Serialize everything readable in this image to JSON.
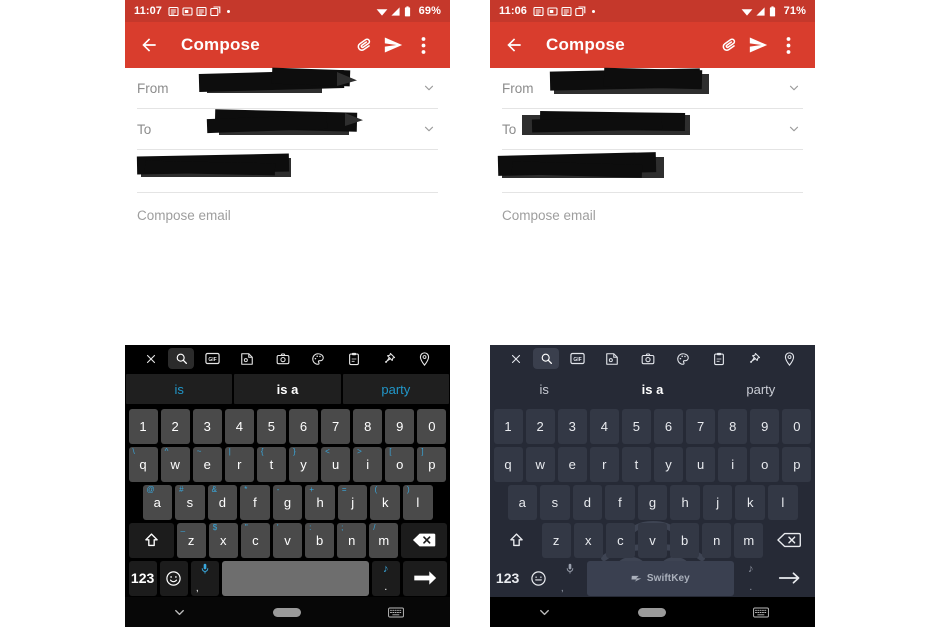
{
  "panels": [
    {
      "id": "left",
      "theme": "dark",
      "status": {
        "time": "11:07",
        "battery": "69%"
      },
      "appbar": {
        "title": "Compose",
        "back_icon": "arrow-back-icon",
        "attach_icon": "attachment-icon",
        "send_icon": "send-icon",
        "overflow_icon": "more-vert-icon"
      },
      "compose": {
        "from_label": "From",
        "to_label": "To",
        "subject_redacted": true,
        "body_placeholder": "Compose email"
      },
      "keyboard": {
        "toolbar": [
          "close-icon",
          "search-icon",
          "gif-icon",
          "sticker-icon",
          "camera-icon",
          "theme-palette-icon",
          "clipboard-icon",
          "pin-icon",
          "location-icon"
        ],
        "suggestions": [
          "is",
          "is a",
          "party"
        ],
        "rows": [
          [
            {
              "main": "1"
            },
            {
              "main": "2"
            },
            {
              "main": "3"
            },
            {
              "main": "4"
            },
            {
              "main": "5"
            },
            {
              "main": "6"
            },
            {
              "main": "7"
            },
            {
              "main": "8"
            },
            {
              "main": "9"
            },
            {
              "main": "0"
            }
          ],
          [
            {
              "main": "q",
              "alt": "\\"
            },
            {
              "main": "w",
              "alt": "^"
            },
            {
              "main": "e",
              "alt": "~"
            },
            {
              "main": "r",
              "alt": "|"
            },
            {
              "main": "t",
              "alt": "{"
            },
            {
              "main": "y",
              "alt": "}"
            },
            {
              "main": "u",
              "alt": "<"
            },
            {
              "main": "i",
              "alt": ">"
            },
            {
              "main": "o",
              "alt": "["
            },
            {
              "main": "p",
              "alt": "]"
            }
          ],
          [
            {
              "main": "a",
              "alt": "@"
            },
            {
              "main": "s",
              "alt": "#"
            },
            {
              "main": "d",
              "alt": "&"
            },
            {
              "main": "f",
              "alt": "*"
            },
            {
              "main": "g",
              "alt": "-"
            },
            {
              "main": "h",
              "alt": "+"
            },
            {
              "main": "j",
              "alt": "="
            },
            {
              "main": "k",
              "alt": "("
            },
            {
              "main": "l",
              "alt": ")"
            }
          ],
          [
            {
              "main": "z",
              "alt": "_"
            },
            {
              "main": "x",
              "alt": "$"
            },
            {
              "main": "c",
              "alt": "\""
            },
            {
              "main": "v",
              "alt": "'"
            },
            {
              "main": "b",
              "alt": ":"
            },
            {
              "main": "n",
              "alt": ";"
            },
            {
              "main": "m",
              "alt": "/"
            }
          ]
        ],
        "shift_icon": "shift-icon",
        "backspace_icon": "backspace-icon",
        "numeric_label": "123",
        "emoji_icon": "emoji-icon",
        "mic_icon": "microphone-icon",
        "mic_alt": ",",
        "space_label": "",
        "period_alt": "♪",
        "period_main": ".",
        "enter_icon": "enter-arrow-icon"
      },
      "navbar": {
        "back_icon": "chevron-down-icon",
        "home_icon": "home-pill-icon",
        "keyboard_icon": "keyboard-icon"
      }
    },
    {
      "id": "right",
      "theme": "incognito",
      "status": {
        "time": "11:06",
        "battery": "71%"
      },
      "appbar": {
        "title": "Compose",
        "back_icon": "arrow-back-icon",
        "attach_icon": "attachment-icon",
        "send_icon": "send-icon",
        "overflow_icon": "more-vert-icon"
      },
      "compose": {
        "from_label": "From",
        "to_label": "To",
        "subject_redacted": true,
        "body_placeholder": "Compose email"
      },
      "keyboard": {
        "toolbar": [
          "close-icon",
          "search-icon",
          "gif-icon",
          "sticker-icon",
          "camera-icon",
          "theme-palette-icon",
          "clipboard-icon",
          "pin-icon",
          "location-icon"
        ],
        "suggestions": [
          "is",
          "is a",
          "party"
        ],
        "rows": [
          [
            {
              "main": "1"
            },
            {
              "main": "2"
            },
            {
              "main": "3"
            },
            {
              "main": "4"
            },
            {
              "main": "5"
            },
            {
              "main": "6"
            },
            {
              "main": "7"
            },
            {
              "main": "8"
            },
            {
              "main": "9"
            },
            {
              "main": "0"
            }
          ],
          [
            {
              "main": "q"
            },
            {
              "main": "w"
            },
            {
              "main": "e"
            },
            {
              "main": "r"
            },
            {
              "main": "t"
            },
            {
              "main": "y"
            },
            {
              "main": "u"
            },
            {
              "main": "i"
            },
            {
              "main": "o"
            },
            {
              "main": "p"
            }
          ],
          [
            {
              "main": "a"
            },
            {
              "main": "s"
            },
            {
              "main": "d"
            },
            {
              "main": "f"
            },
            {
              "main": "g"
            },
            {
              "main": "h"
            },
            {
              "main": "j"
            },
            {
              "main": "k"
            },
            {
              "main": "l"
            }
          ],
          [
            {
              "main": "z"
            },
            {
              "main": "x"
            },
            {
              "main": "c"
            },
            {
              "main": "v"
            },
            {
              "main": "b"
            },
            {
              "main": "n"
            },
            {
              "main": "m"
            }
          ]
        ],
        "shift_icon": "shift-icon",
        "backspace_icon": "backspace-icon",
        "numeric_label": "123",
        "emoji_icon": "emoji-icon",
        "mic_icon": "microphone-icon",
        "mic_alt": ",",
        "space_label": "SwiftKey",
        "period_alt": "♪",
        "period_main": ".",
        "enter_icon": "enter-arrow-icon",
        "watermark": "incognito-icon"
      },
      "navbar": {
        "back_icon": "chevron-down-icon",
        "home_icon": "home-pill-icon",
        "keyboard_icon": "keyboard-icon"
      }
    }
  ],
  "colors": {
    "status_bar": "#c5382b",
    "app_bar": "#d93d2d",
    "keyboard_dark_bg": "#000000",
    "keyboard_dark_key": "#4a4a4a",
    "keyboard_incognito_bg": "#262a36",
    "keyboard_incognito_key": "#333845",
    "suggestion_accent": "#2196c8",
    "alt_char": "#39a8dd"
  }
}
